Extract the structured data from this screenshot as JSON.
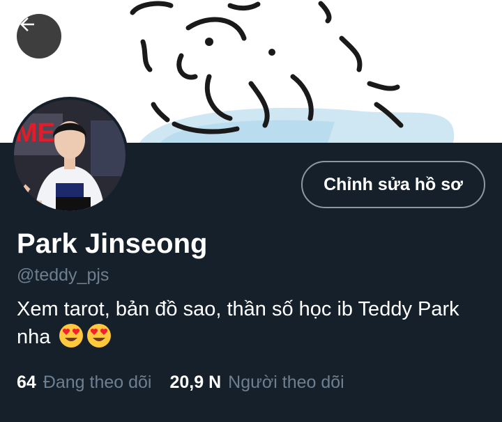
{
  "header": {
    "back_icon": "arrow-left-icon",
    "banner_description_colors": {
      "sky_blue": "#cfe6f3",
      "line": "#1a1a1a"
    }
  },
  "profile": {
    "edit_button_label": "Chỉnh sửa hồ sơ",
    "display_name": "Park Jinseong",
    "handle": "@teddy_pjs",
    "bio": "Xem tarot, bản đồ sao, thần số học ib Teddy Park nha",
    "bio_emojis": [
      "heart-eyes-emoji",
      "heart-eyes-emoji"
    ]
  },
  "stats": {
    "following_count": "64",
    "following_label": "Đang theo dõi",
    "followers_count": "20,9 N",
    "followers_label": "Người theo dõi"
  },
  "colors": {
    "background": "#15202b",
    "muted_text": "#6e7f8f",
    "button_border": "#8b98a5",
    "emoji_face": "#ffc83d",
    "emoji_heart": "#f4212e"
  }
}
